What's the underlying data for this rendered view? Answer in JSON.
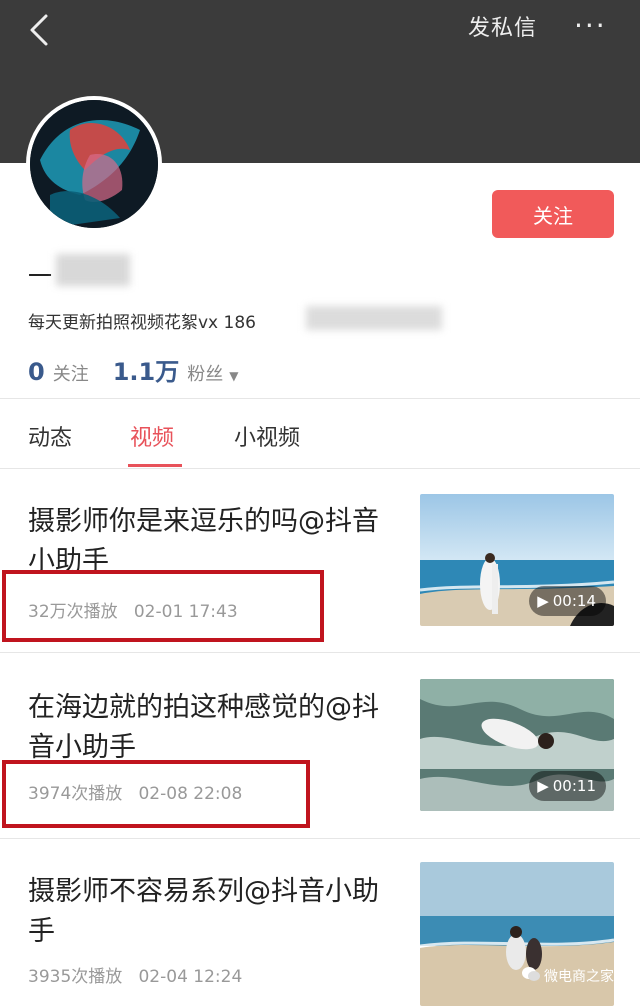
{
  "header": {
    "dm_label": "发私信",
    "more_label": "···"
  },
  "profile": {
    "name_visible": "一",
    "bio_visible": "每天更新拍照视频花絮vx 186",
    "follow_button": "关注",
    "following_count": "0",
    "following_label": "关注",
    "fans_count": "1.1万",
    "fans_label": "粉丝"
  },
  "tabs": [
    {
      "label": "动态",
      "active": false
    },
    {
      "label": "视频",
      "active": true
    },
    {
      "label": "小视频",
      "active": false
    }
  ],
  "videos": [
    {
      "title": "摄影师你是来逗乐的吗@抖音小助手",
      "plays": "32万次播放",
      "date": "02-01 17:43",
      "duration": "00:14"
    },
    {
      "title": "在海边就的拍这种感觉的@抖音小助手",
      "plays": "3974次播放",
      "date": "02-08 22:08",
      "duration": "00:11"
    },
    {
      "title": "摄影师不容易系列@抖音小助手",
      "plays": "3935次播放",
      "date": "02-04 12:24",
      "duration": ""
    }
  ],
  "watermark": "微电商之家",
  "colors": {
    "accent": "#e8525a",
    "follow_button": "#f15a5a",
    "header": "#3b3b3b",
    "highlight_box": "#c0141e"
  }
}
